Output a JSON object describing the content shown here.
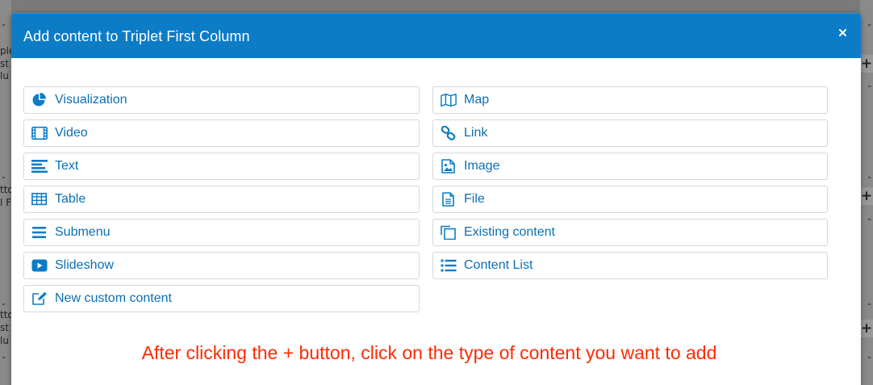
{
  "modal": {
    "title": "Add content to Triplet First Column",
    "close_symbol": "×"
  },
  "items": [
    {
      "label": "Visualization",
      "icon": "pie-chart-icon"
    },
    {
      "label": "Map",
      "icon": "map-icon"
    },
    {
      "label": "Video",
      "icon": "film-icon"
    },
    {
      "label": "Link",
      "icon": "link-icon"
    },
    {
      "label": "Text",
      "icon": "align-left-icon"
    },
    {
      "label": "Image",
      "icon": "image-file-icon"
    },
    {
      "label": "Table",
      "icon": "table-icon"
    },
    {
      "label": "File",
      "icon": "file-text-icon"
    },
    {
      "label": "Submenu",
      "icon": "bars-icon"
    },
    {
      "label": "Existing content",
      "icon": "copy-icon"
    },
    {
      "label": "Slideshow",
      "icon": "youtube-play-icon"
    },
    {
      "label": "Content List",
      "icon": "list-icon"
    },
    {
      "label": "New custom content",
      "icon": "edit-icon"
    }
  ],
  "annotation": "After clicking the + button, click on the type of content you want to add",
  "background": {
    "plus_label": "+",
    "dash_label": "-",
    "left_fragments": [
      "ple",
      "st",
      "lu",
      "tto",
      "l F",
      "tto",
      "st",
      "lu"
    ]
  },
  "colors": {
    "header": "#0d7cc7",
    "link": "#0b6fb3",
    "annotation": "#ff2a00"
  }
}
